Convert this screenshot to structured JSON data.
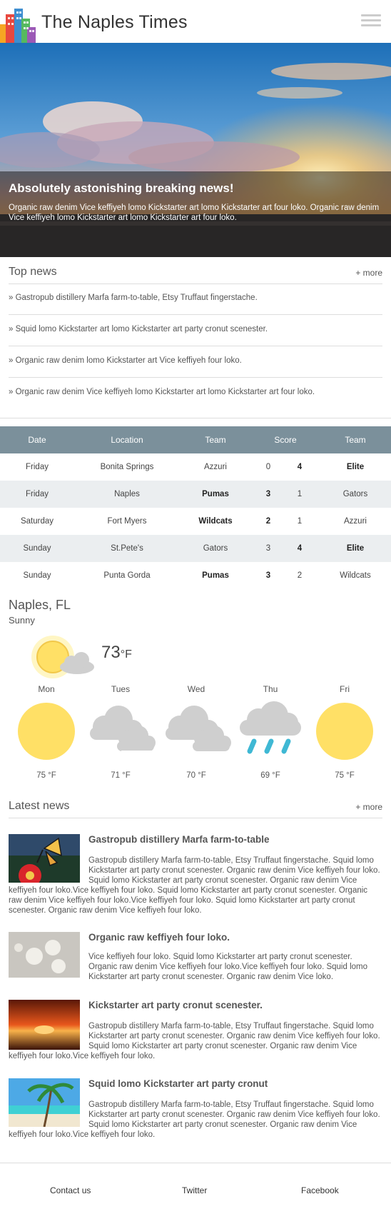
{
  "header": {
    "title": "The Naples Times",
    "logo_icon": "city-buildings-icon",
    "menu_icon": "hamburger-menu-icon"
  },
  "hero": {
    "title": "Absolutely astonishing breaking news!",
    "text": "Organic raw denim Vice keffiyeh lomo Kickstarter art lomo Kickstarter art four loko. Organic raw denim Vice keffiyeh lomo Kickstarter art lomo Kickstarter art four loko."
  },
  "top_news": {
    "title": "Top news",
    "more": "+ more",
    "items": [
      "» Gastropub distillery Marfa farm-to-table, Etsy Truffaut fingerstache.",
      "» Squid lomo Kickstarter art lomo Kickstarter art party cronut scenester.",
      "» Organic raw denim lomo Kickstarter art Vice keffiyeh four loko.",
      "» Organic raw denim Vice keffiyeh lomo Kickstarter art lomo Kickstarter art four loko."
    ]
  },
  "scores": {
    "headers": [
      "Date",
      "Location",
      "Team",
      "Score",
      "Team"
    ],
    "rows": [
      {
        "date": "Friday",
        "location": "Bonita Springs",
        "team1": "Azzuri",
        "s1": "0",
        "s2": "4",
        "team2": "Elite"
      },
      {
        "date": "Friday",
        "location": "Naples",
        "team1": "Pumas",
        "s1": "3",
        "s2": "1",
        "team2": "Gators"
      },
      {
        "date": "Saturday",
        "location": "Fort Myers",
        "team1": "Wildcats",
        "s1": "2",
        "s2": "1",
        "team2": "Azzuri"
      },
      {
        "date": "Sunday",
        "location": "St.Pete's",
        "team1": "Gators",
        "s1": "3",
        "s2": "4",
        "team2": "Elite"
      },
      {
        "date": "Sunday",
        "location": "Punta Gorda",
        "team1": "Pumas",
        "s1": "3",
        "s2": "2",
        "team2": "Wildcats"
      }
    ]
  },
  "weather": {
    "city": "Naples, FL",
    "condition": "Sunny",
    "current_temp": "73",
    "unit": "°F",
    "current_icon": "sun-behind-cloud-icon",
    "forecast": [
      {
        "day": "Mon",
        "temp": "75 °F",
        "icon": "sun-icon"
      },
      {
        "day": "Tues",
        "temp": "71 °F",
        "icon": "cloud-icon"
      },
      {
        "day": "Wed",
        "temp": "70 °F",
        "icon": "cloud-icon"
      },
      {
        "day": "Thu",
        "temp": "69 °F",
        "icon": "rain-cloud-icon"
      },
      {
        "day": "Fri",
        "temp": "75 °F",
        "icon": "sun-icon"
      }
    ]
  },
  "latest_news": {
    "title": "Latest news",
    "more": "+ more",
    "articles": [
      {
        "title": "Gastropub distillery Marfa farm-to-table",
        "image": "butterfly-on-red-flower-thumbnail",
        "text": "Gastropub distillery Marfa farm-to-table, Etsy Truffaut fingerstache. Squid lomo Kickstarter art party cronut scenester. Organic raw denim Vice keffiyeh four loko. Squid lomo Kickstarter art party cronut scenester. Organic raw denim Vice keffiyeh four loko.Vice keffiyeh four loko. Squid lomo Kickstarter art party cronut scenester. Organic raw denim Vice keffiyeh four loko.Vice keffiyeh four loko. Squid lomo Kickstarter art party cronut scenester. Organic raw denim Vice keffiyeh four loko."
      },
      {
        "title": "Organic raw keffiyeh four loko.",
        "image": "sand-dollars-on-sand-thumbnail",
        "text": "Vice keffiyeh four loko. Squid lomo Kickstarter art party cronut scenester. Organic raw denim Vice keffiyeh four loko.Vice keffiyeh four loko. Squid lomo Kickstarter art party cronut scenester. Organic raw denim Vice loko."
      },
      {
        "title": "Kickstarter art party cronut scenester.",
        "image": "sunset-over-sea-thumbnail",
        "text": "Gastropub distillery Marfa farm-to-table, Etsy Truffaut fingerstache. Squid lomo Kickstarter art party cronut scenester. Organic raw denim Vice keffiyeh four loko. Squid lomo Kickstarter art party cronut scenester. Organic raw denim Vice keffiyeh four loko.Vice keffiyeh four loko."
      },
      {
        "title": "Squid lomo Kickstarter art party cronut",
        "image": "palm-tree-beach-thumbnail",
        "text": "Gastropub distillery Marfa farm-to-table, Etsy Truffaut fingerstache. Squid lomo Kickstarter art party cronut scenester. Organic raw denim Vice keffiyeh four loko. Squid lomo Kickstarter art party cronut scenester. Organic raw denim Vice keffiyeh four loko.Vice keffiyeh four loko."
      }
    ]
  },
  "footer": {
    "links": [
      "Contact us",
      "Twitter",
      "Facebook"
    ]
  },
  "colors": {
    "table_header": "#7b909b",
    "table_alt_row": "#ebeef0",
    "sun": "#ffe066",
    "cloud": "#cfcfcf",
    "rain": "#3fb8d4"
  }
}
